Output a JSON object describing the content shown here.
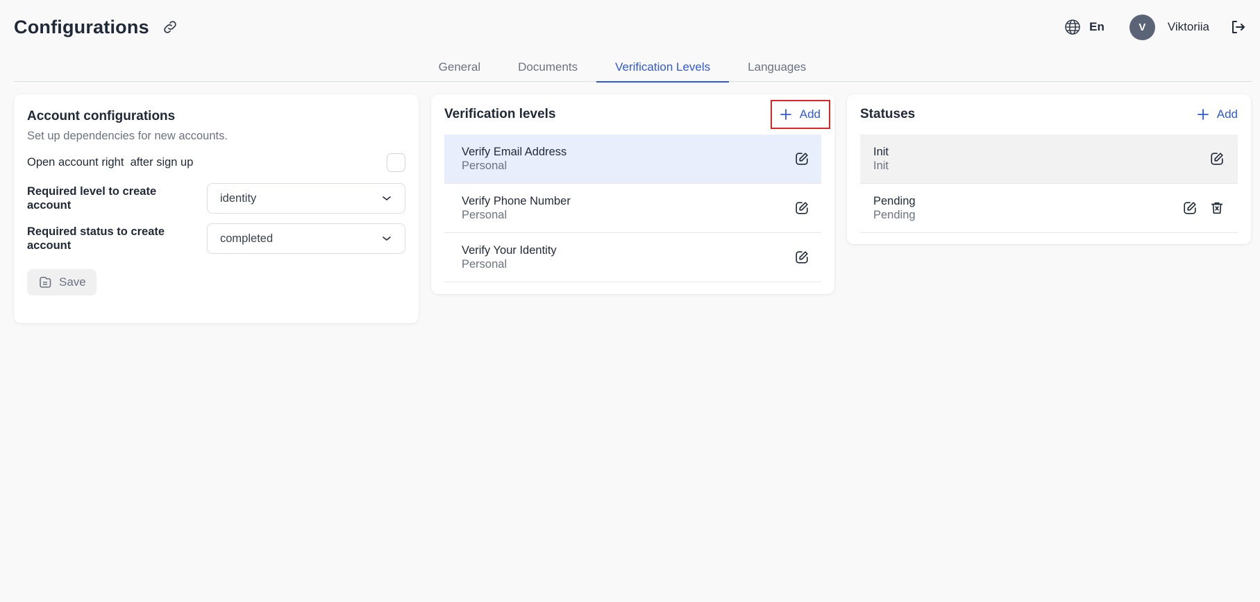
{
  "header": {
    "title": "Configurations",
    "language": "En",
    "user_initial": "V",
    "user_name": "Viktoriia"
  },
  "tabs": [
    {
      "label": "General",
      "active": false
    },
    {
      "label": "Documents",
      "active": false
    },
    {
      "label": "Verification Levels",
      "active": true
    },
    {
      "label": "Languages",
      "active": false
    }
  ],
  "account": {
    "title": "Account configurations",
    "subtitle": "Set up dependencies for new accounts.",
    "open_account_label": "Open account right  after sign up",
    "open_account_checked": false,
    "required_level_label": "Required level to create account",
    "required_level_value": "identity",
    "required_status_label": "Required status to create account",
    "required_status_value": "completed",
    "save_label": "Save"
  },
  "levels": {
    "title": "Verification levels",
    "add_label": "Add",
    "items": [
      {
        "name": "Verify Email Address",
        "type": "Personal"
      },
      {
        "name": "Verify Phone Number",
        "type": "Personal"
      },
      {
        "name": "Verify Your Identity",
        "type": "Personal"
      }
    ]
  },
  "statuses": {
    "title": "Statuses",
    "add_label": "Add",
    "items": [
      {
        "name": "Init",
        "sub": "Init"
      },
      {
        "name": "Pending",
        "sub": "Pending"
      }
    ]
  },
  "colors": {
    "accent": "#2f58e0",
    "highlight_box": "#e02424",
    "selected_row": "#e8eefc",
    "avatar": "#5b6477"
  }
}
